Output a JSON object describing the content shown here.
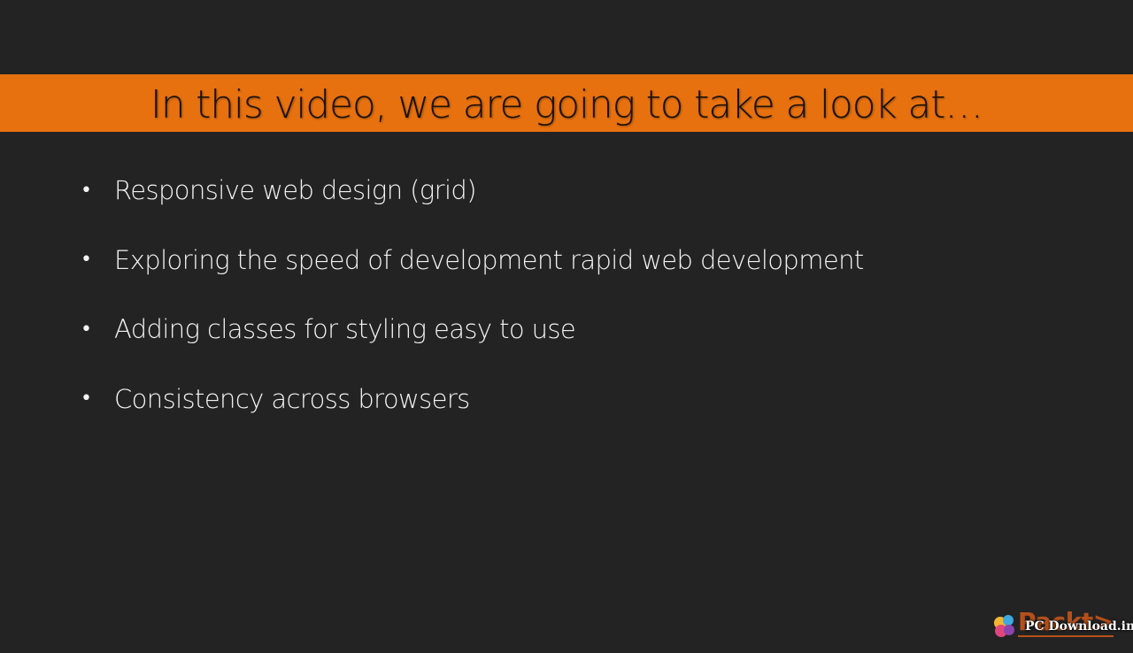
{
  "slide": {
    "title": "In this video, we are going to take a look at…",
    "bullets": [
      "Responsive web design (grid)",
      "Exploring the speed of development rapid web development",
      "Adding classes for styling easy to use",
      "Consistency across browsers"
    ],
    "bullet_glyph": "•"
  },
  "brand": {
    "logo_text": "Packt>"
  },
  "watermark": {
    "text": "PC Download.in",
    "icon": "colorful-circles-icon"
  },
  "colors": {
    "background": "#232323",
    "title_bar": "#e8710f",
    "title_text": "#1a1206",
    "bullet_text": "#f2f2f2",
    "brand": "#b5501a"
  }
}
